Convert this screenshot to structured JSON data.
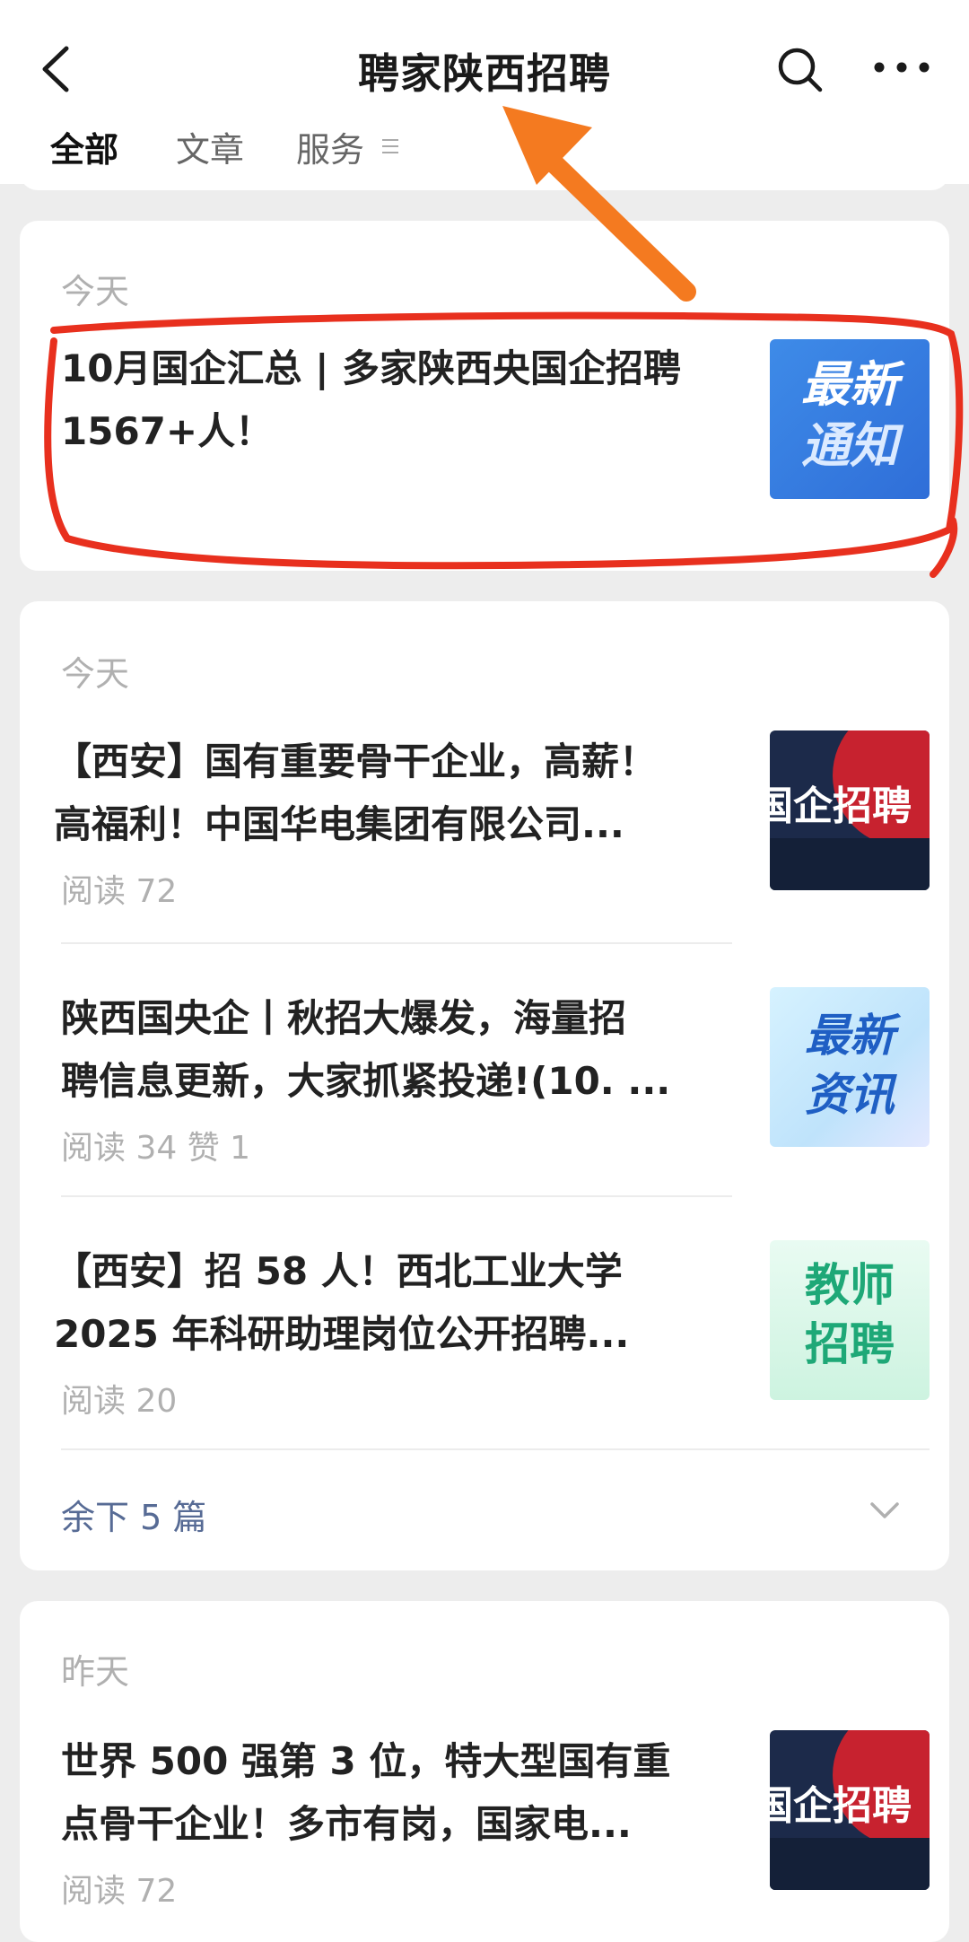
{
  "header": {
    "title": "聘家陕西招聘",
    "tabs": [
      {
        "label": "全部",
        "active": true
      },
      {
        "label": "文章",
        "active": false
      },
      {
        "label": "服务",
        "active": false
      }
    ]
  },
  "groups": [
    {
      "date": "今天",
      "articles": [
        {
          "title": "10月国企汇总 | 多家陕西央国企招聘1567+人！",
          "meta": "",
          "thumb": {
            "text_line1": "最新",
            "text_line2": "通知",
            "style": "blue-notice"
          }
        }
      ]
    },
    {
      "date": "今天",
      "articles": [
        {
          "title_line1": "【西安】国有重要骨干企业，高薪！",
          "title_line2": "高福利！中国华电集团有限公司...",
          "meta": "阅读 72",
          "thumb": {
            "text": "国企招聘",
            "style": "dark-red"
          }
        },
        {
          "title_line1": "陕西国央企丨秋招大爆发，海量招",
          "title_line2": "聘信息更新，大家抓紧投递!(10. ...",
          "meta": "阅读 34  赞 1",
          "thumb": {
            "text_line1": "最新",
            "text_line2": "资讯",
            "style": "light-blue"
          }
        },
        {
          "title_line1": "【西安】招 58 人！西北工业大学",
          "title_line2": "2025 年科研助理岗位公开招聘...",
          "meta": "阅读 20",
          "thumb": {
            "text_line1": "教师",
            "text_line2": "招聘",
            "style": "mint"
          }
        }
      ],
      "more_label": "余下 5 篇"
    },
    {
      "date": "昨天",
      "articles": [
        {
          "title_line1": "世界 500 强第 3 位，特大型国有重",
          "title_line2": "点骨干企业！多市有岗，国家电...",
          "meta": "阅读 72",
          "thumb": {
            "text": "国企招聘",
            "style": "dark-red"
          }
        }
      ]
    }
  ],
  "colors": {
    "annotation_red": "#e8301e",
    "annotation_orange": "#f47a20",
    "link_blue": "#576b95"
  }
}
